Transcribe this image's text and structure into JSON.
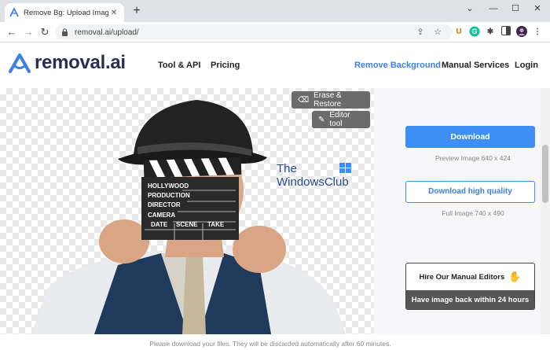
{
  "browser": {
    "tab_title": "Remove Bg: Upload Image to Cre",
    "tab_close_glyph": "✕",
    "new_tab_glyph": "+",
    "window_controls": {
      "minimize": "—",
      "maximize": "☐",
      "close": "✕"
    },
    "url": "removal.ai/upload/",
    "nav_glyphs": {
      "back": "←",
      "forward": "→",
      "reload": "↻"
    },
    "extensions": [
      {
        "name": "u-icon",
        "glyph": "U",
        "color": "#e8710a"
      },
      {
        "name": "grammarly-icon",
        "glyph": "G",
        "color": "#15c39a"
      },
      {
        "name": "puzzle-icon",
        "glyph": "✱",
        "color": "#444444"
      },
      {
        "name": "sidebar-icon",
        "glyph": "▮",
        "color": "#444444"
      }
    ]
  },
  "site": {
    "logo_text": "removal.ai",
    "brand_color": "#3d7fe6",
    "nav": {
      "tool_api": "Tool & API",
      "pricing": "Pricing",
      "remove_background": "Remove Background",
      "manual_services": "Manual Services",
      "login": "Login"
    }
  },
  "editor": {
    "erase_restore": "Erase & Restore",
    "editor_tool": "Editor tool",
    "clapperboard": {
      "hollywood": "HOLLYWOOD",
      "production": "PRODUCTION",
      "director": "DIRECTOR",
      "camera": "CAMERA",
      "date": "DATE",
      "scene": "SCENE",
      "take": "TAKE"
    }
  },
  "watermark": {
    "line1": "The",
    "line2": "WindowsClub"
  },
  "sidebar": {
    "download_label": "Download",
    "preview_info": "Preview Image   640 x 424",
    "download_hq_label": "Download high quality",
    "full_info": "Full Image   740 x 490",
    "hire_label": "Hire Our Manual Editors",
    "hire_sub": "Have image back within 24 hours"
  },
  "footer": {
    "note": "Please download your files. They will be discarded automatically after 60 minutes."
  }
}
